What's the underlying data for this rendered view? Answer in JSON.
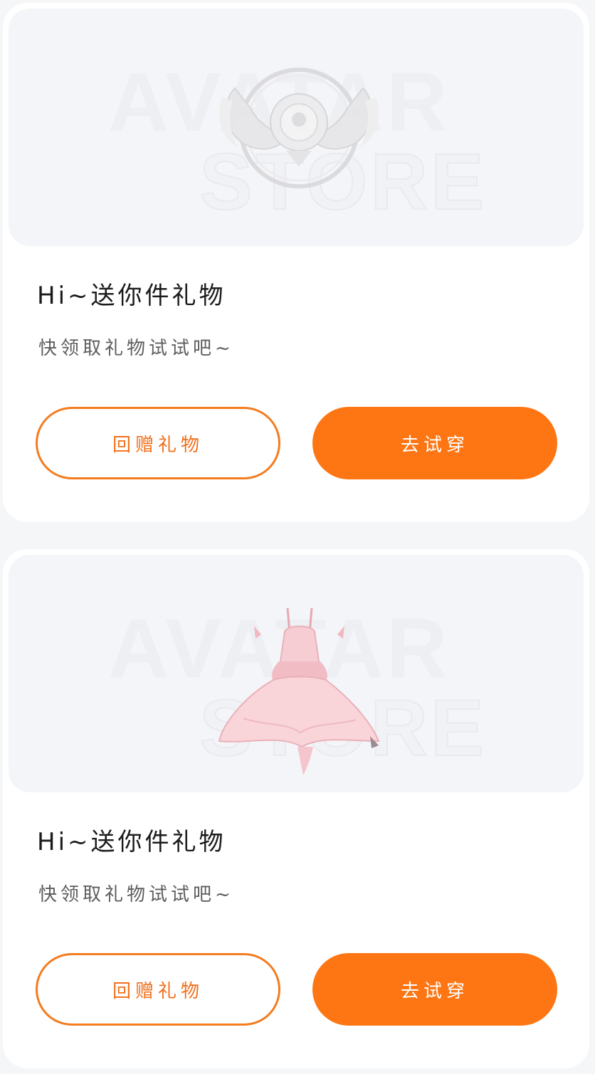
{
  "colors": {
    "accent": "#fd7613",
    "accent_border": "#f47b1e",
    "page_bg": "#f5f6f8",
    "card_bg": "#ffffff",
    "hero_bg": "#f4f5f8"
  },
  "cards": [
    {
      "watermark_line1": "AVATAR",
      "watermark_line2": "STORE",
      "item_icon": "winged-badge-icon",
      "title": "Hi~送你件礼物",
      "subtitle": "快领取礼物试试吧~",
      "return_gift_label": "回赠礼物",
      "try_on_label": "去试穿"
    },
    {
      "watermark_line1": "AVATAR",
      "watermark_line2": "STORE",
      "item_icon": "pink-dress-icon",
      "title": "Hi~送你件礼物",
      "subtitle": "快领取礼物试试吧~",
      "return_gift_label": "回赠礼物",
      "try_on_label": "去试穿"
    }
  ]
}
